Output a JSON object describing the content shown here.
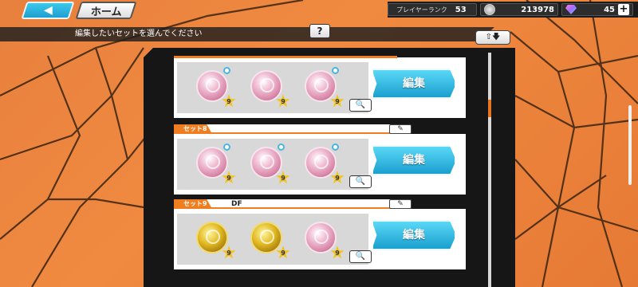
{
  "top_bar": {
    "back_icon": "left-triangle-icon",
    "home_label": "ホーム",
    "player_rank_label": "プレイヤーランク",
    "player_rank_value": "53",
    "coins_value": "213978",
    "gems_value": "45",
    "plus_label": "+"
  },
  "instruction": {
    "text": "編集したいセットを選んでください",
    "help_label": "?",
    "sort_label": "⇧🡇"
  },
  "sets": [
    {
      "tab": "",
      "name": "",
      "medals": [
        {
          "color": "pink",
          "level": "9"
        },
        {
          "color": "pink",
          "level": "9"
        },
        {
          "color": "pink",
          "level": "9"
        }
      ],
      "edit_label": "編集"
    },
    {
      "tab": "セット8",
      "name": "",
      "medals": [
        {
          "color": "pink",
          "level": "9"
        },
        {
          "color": "pink",
          "level": "9"
        },
        {
          "color": "pink",
          "level": "9"
        }
      ],
      "edit_label": "編集"
    },
    {
      "tab": "セット9",
      "name": "DF",
      "medals": [
        {
          "color": "gold",
          "level": "9"
        },
        {
          "color": "gold",
          "level": "9"
        },
        {
          "color": "pink",
          "level": "9"
        }
      ],
      "edit_label": "編集"
    }
  ],
  "colors": {
    "accent_orange": "#f07d1f",
    "button_blue": "#1a9fcf",
    "panel_dark": "#161616"
  }
}
